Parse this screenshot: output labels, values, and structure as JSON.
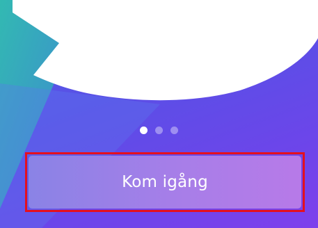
{
  "onboarding": {
    "pager": {
      "page_count": 3,
      "active_index": 0
    },
    "primary_button": {
      "label": "Kom igång",
      "highlighted": true
    }
  },
  "colors": {
    "background_start": "#4d63e8",
    "background_end": "#7e40ec",
    "teal_accent": "#2fb7a8",
    "button_start": "#8a83e6",
    "button_end": "#b77ae8",
    "highlight_border": "#e5101e",
    "text": "#ffffff"
  }
}
